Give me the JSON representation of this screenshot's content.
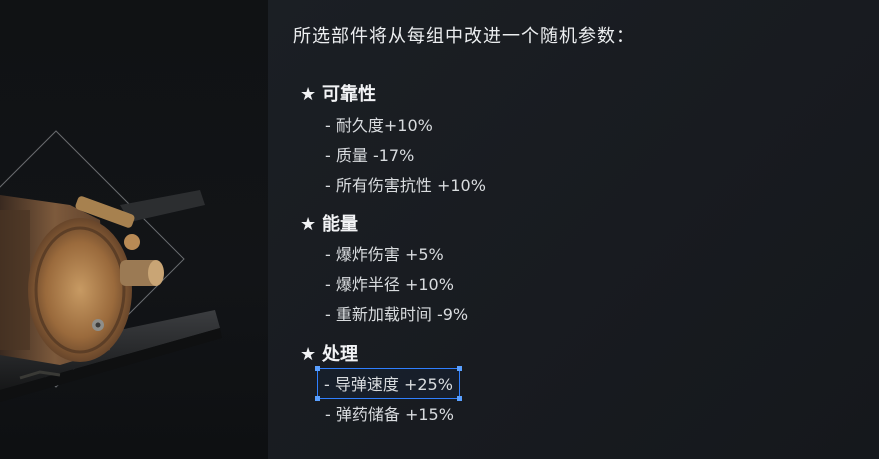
{
  "intro_text": "所选部件将从每组中改进一个随机参数：",
  "groups": [
    {
      "icon": "star-icon",
      "star": "★",
      "title": "可靠性",
      "stats": [
        "- 耐久度+10%",
        "- 质量 -17%",
        "- 所有伤害抗性 +10%"
      ]
    },
    {
      "icon": "star-icon",
      "star": "★",
      "title": "能量",
      "stats": [
        "- 爆炸伤害 +5%",
        "- 爆炸半径 +10%",
        "- 重新加载时间 -9%"
      ]
    },
    {
      "icon": "star-icon",
      "star": "★",
      "title": "处理",
      "stats": [
        "- 导弹速度 +25%",
        "- 弹药储备 +15%"
      ]
    }
  ],
  "selected_stat": "- 导弹速度 +25%",
  "colors": {
    "selection_border": "#2f7fff",
    "text": "#e6e8ea",
    "background": "#16191d"
  }
}
